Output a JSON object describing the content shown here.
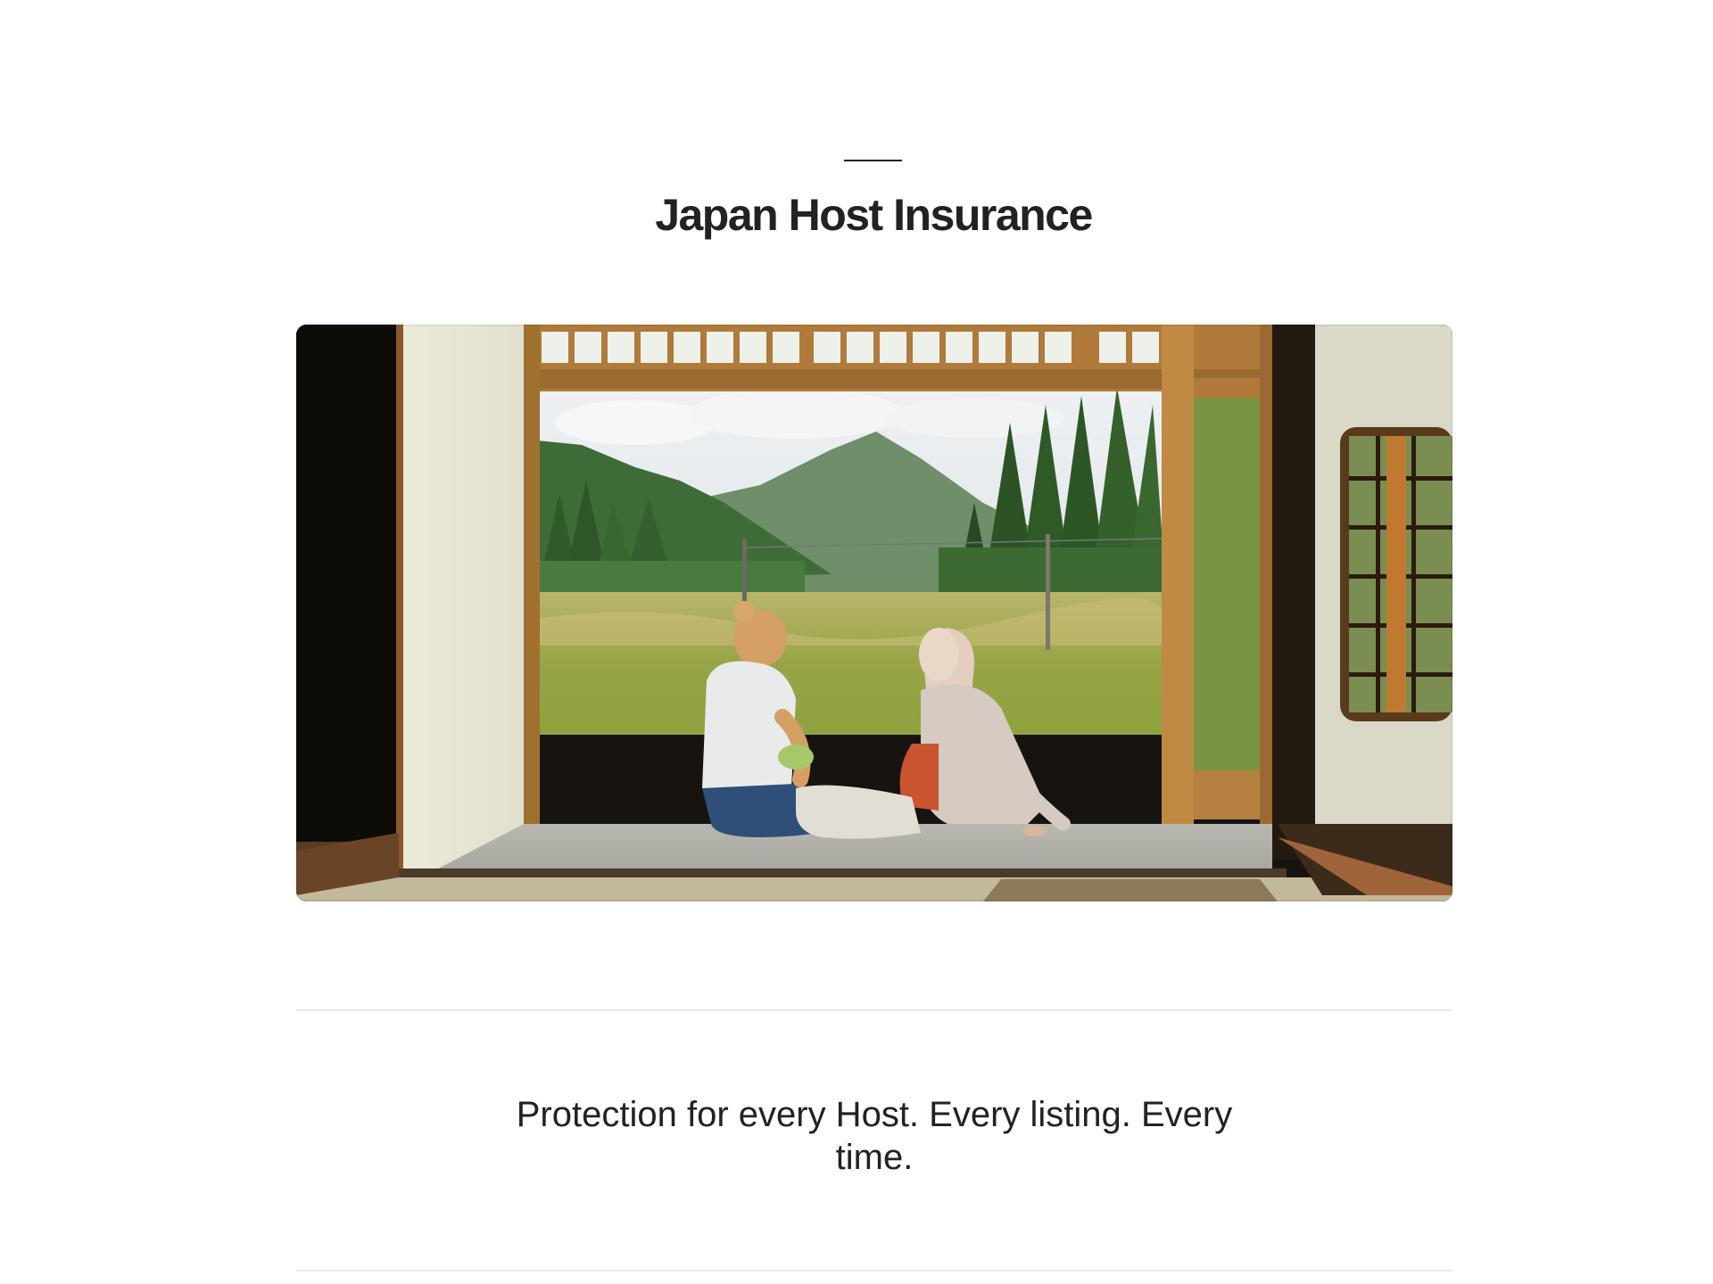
{
  "page": {
    "title": "Japan Host Insurance",
    "tagline": "Protection for every Host. Every listing. Every time."
  },
  "hero_image": {
    "icon": "hero-photo",
    "description_visible": false
  },
  "colors": {
    "text": "#222222",
    "divider": "#ebebeb",
    "background": "#ffffff"
  }
}
